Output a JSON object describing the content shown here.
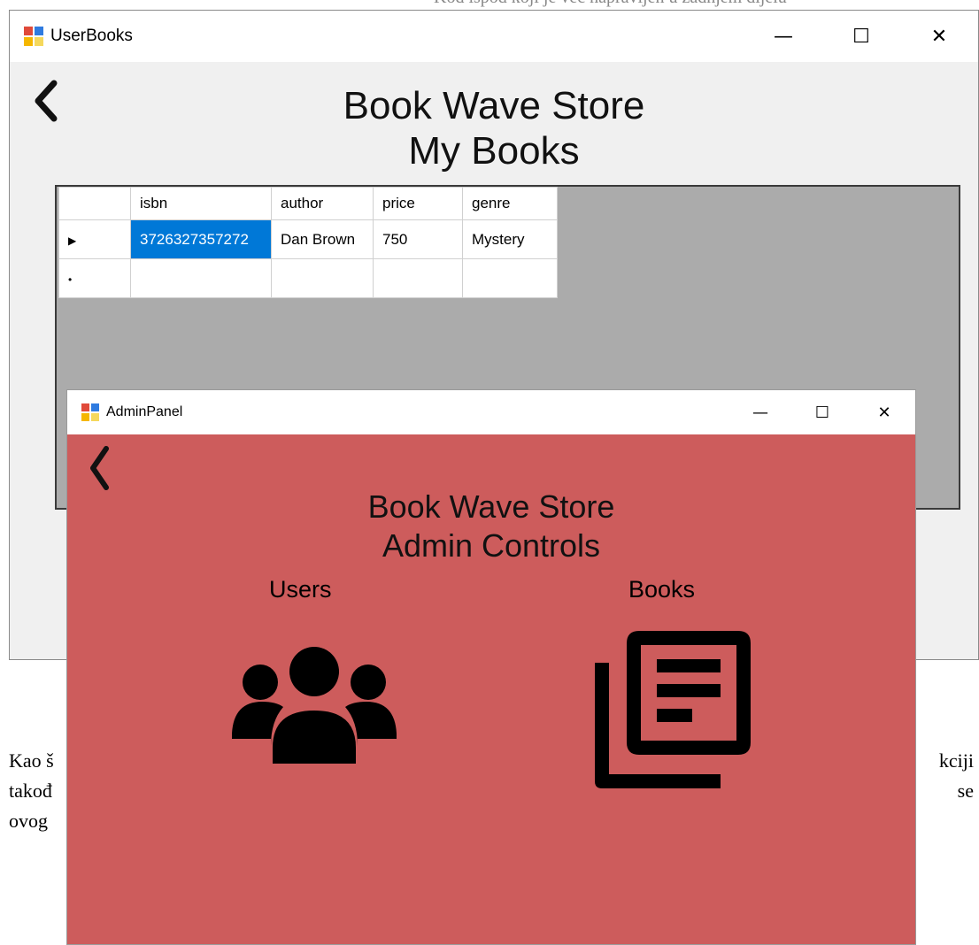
{
  "document": {
    "top_fragment": "Kod ispod koji je već napravljen u zadnjem dijelu",
    "lines": [
      {
        "left": "Kao š",
        "right": "kciji"
      },
      {
        "left": "takođ",
        "right": "se"
      },
      {
        "left": "ovog",
        "right": ""
      }
    ]
  },
  "user_books": {
    "title": "UserBooks",
    "controls": {
      "minimize": "—",
      "maximize": "☐",
      "close": "✕"
    },
    "back": "❮",
    "heading_line1": "Book Wave Store",
    "heading_line2": "My Books",
    "grid": {
      "columns": [
        "isbn",
        "author",
        "price",
        "genre"
      ],
      "rows": [
        {
          "marker": "▶",
          "isbn": "3726327357272",
          "author": "Dan Brown",
          "price": "750",
          "genre": "Mystery"
        },
        {
          "marker": "•",
          "isbn": "",
          "author": "",
          "price": "",
          "genre": ""
        }
      ]
    }
  },
  "admin_panel": {
    "title": "AdminPanel",
    "controls": {
      "minimize": "—",
      "maximize": "☐",
      "close": "✕"
    },
    "back": "❮",
    "heading_line1": "Book Wave Store",
    "heading_line2": "Admin Controls",
    "users_label": "Users",
    "books_label": "Books",
    "icons": {
      "users": "users-group-icon",
      "books": "library-books-icon"
    },
    "colors": {
      "background": "#cd5c5c"
    }
  }
}
